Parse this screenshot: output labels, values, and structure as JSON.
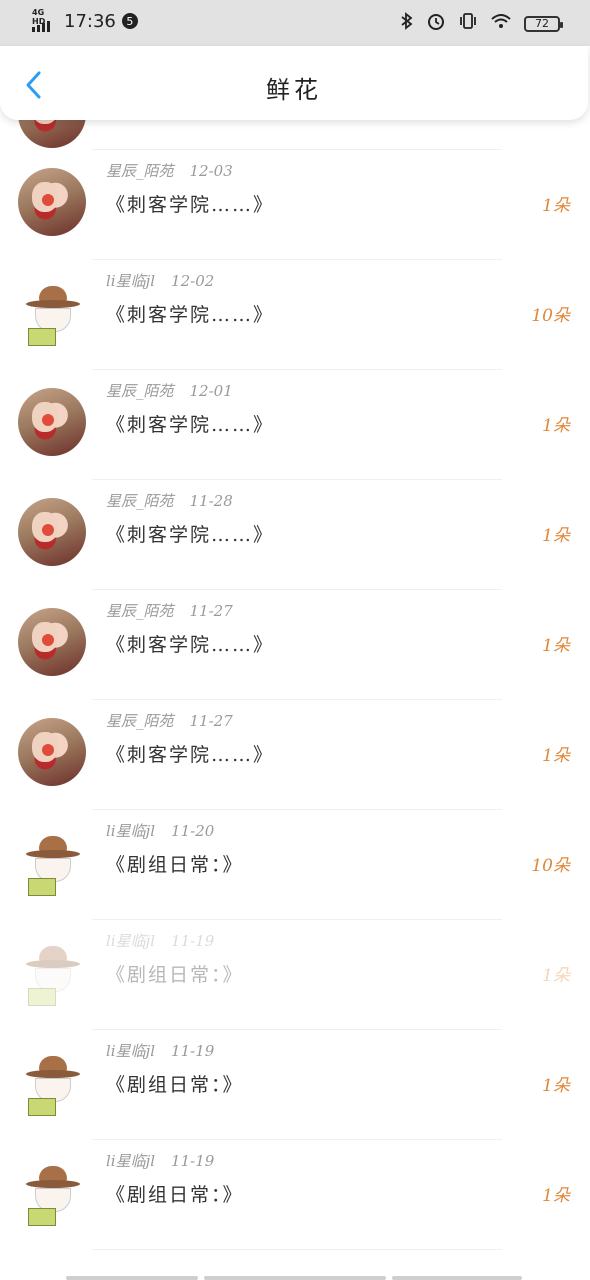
{
  "status_bar": {
    "network": "4G HD",
    "time": "17:36",
    "notification_count": "5",
    "battery": "72",
    "icons": [
      "bluetooth-icon",
      "alarm-icon",
      "vibrate-icon",
      "wifi-icon",
      "battery-icon"
    ]
  },
  "header": {
    "title": "鲜花",
    "back_icon": "chevron-left-icon",
    "accent_color": "#2b9df0"
  },
  "colors": {
    "count": "#e0883a",
    "meta": "#9a9a9a",
    "work": "#333333"
  },
  "records": [
    {
      "user": "星辰_陌苑",
      "date": "12-03",
      "work": "《刺客学院……》",
      "count": "1朵",
      "avatar": "girl",
      "faded": false
    },
    {
      "user": "li星临jl",
      "date": "12-02",
      "work": "《刺客学院……》",
      "count": "10朵",
      "avatar": "chibi",
      "faded": false
    },
    {
      "user": "星辰_陌苑",
      "date": "12-01",
      "work": "《刺客学院……》",
      "count": "1朵",
      "avatar": "girl",
      "faded": false
    },
    {
      "user": "星辰_陌苑",
      "date": "11-28",
      "work": "《刺客学院……》",
      "count": "1朵",
      "avatar": "girl",
      "faded": false
    },
    {
      "user": "星辰_陌苑",
      "date": "11-27",
      "work": "《刺客学院……》",
      "count": "1朵",
      "avatar": "girl",
      "faded": false
    },
    {
      "user": "星辰_陌苑",
      "date": "11-27",
      "work": "《刺客学院……》",
      "count": "1朵",
      "avatar": "girl",
      "faded": false
    },
    {
      "user": "li星临jl",
      "date": "11-20",
      "work": "《剧组日常：》",
      "count": "10朵",
      "avatar": "chibi",
      "faded": false
    },
    {
      "user": "li星临jl",
      "date": "11-19",
      "work": "《剧组日常：》",
      "count": "1朵",
      "avatar": "chibi",
      "faded": true
    },
    {
      "user": "li星临jl",
      "date": "11-19",
      "work": "《剧组日常：》",
      "count": "1朵",
      "avatar": "chibi",
      "faded": false
    },
    {
      "user": "li星临jl",
      "date": "11-19",
      "work": "《剧组日常：》",
      "count": "1朵",
      "avatar": "chibi",
      "faded": false
    }
  ]
}
